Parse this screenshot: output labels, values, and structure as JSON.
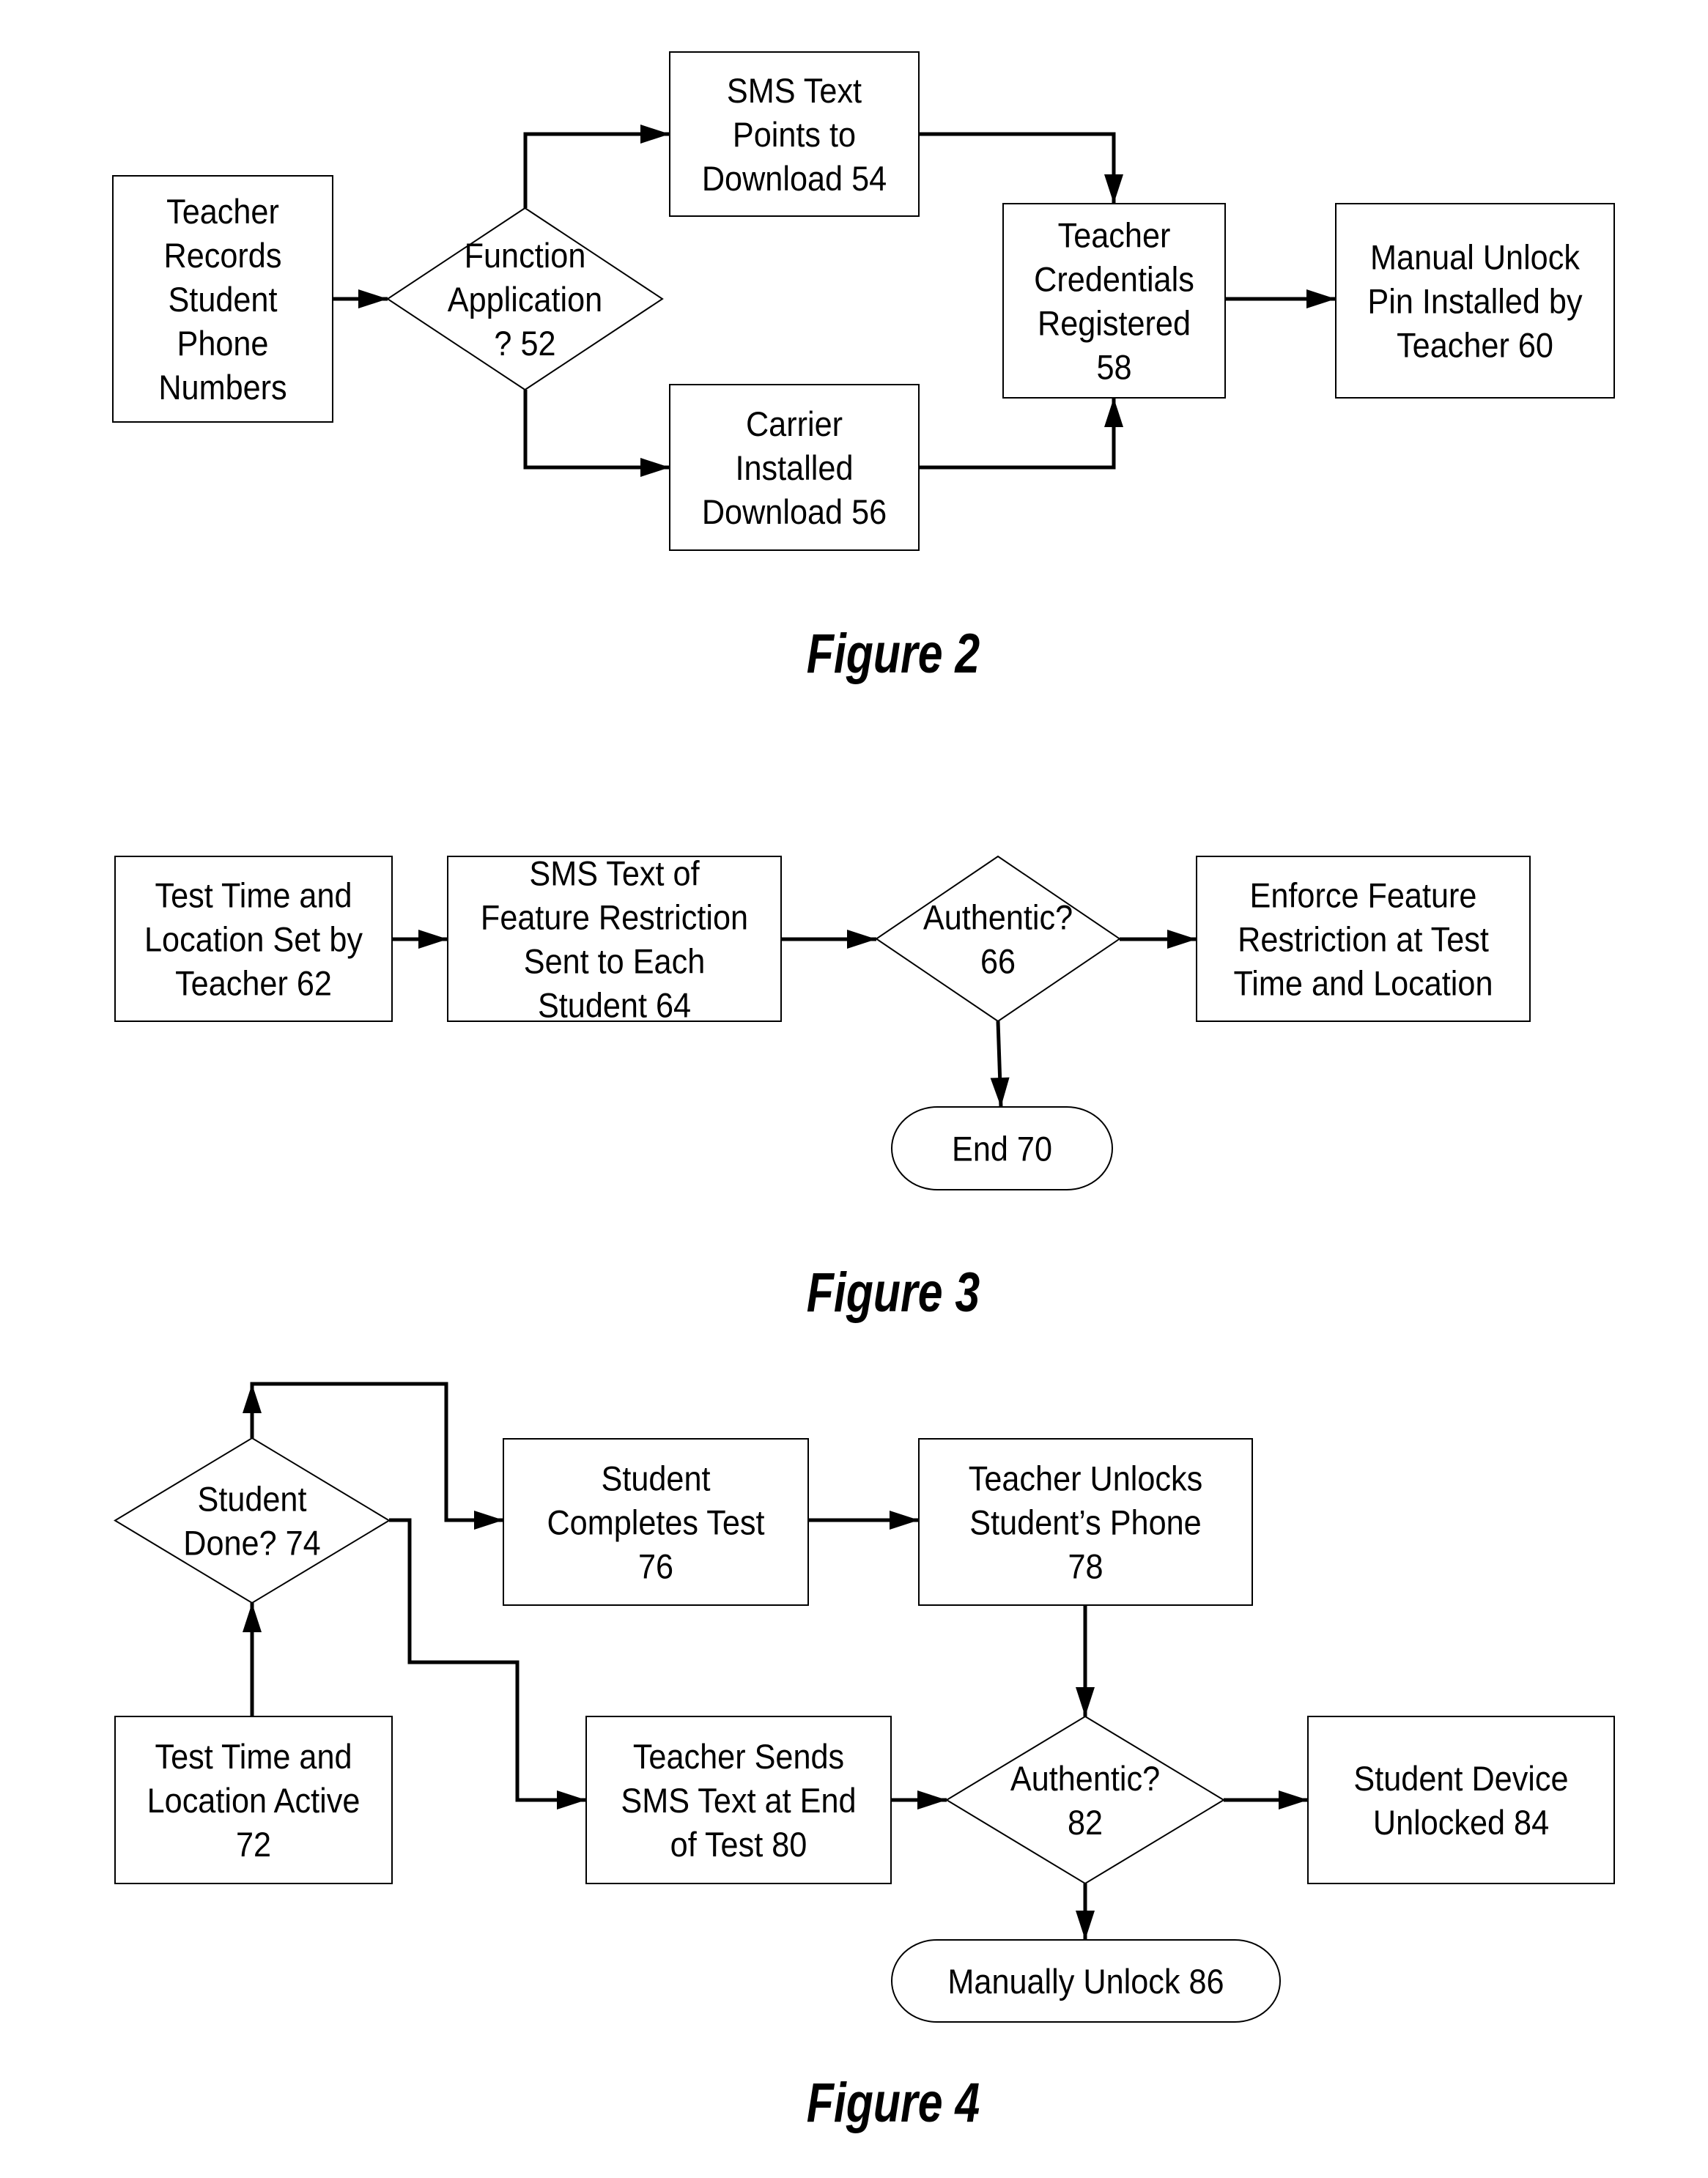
{
  "figures": [
    {
      "caption": "Figure 2",
      "nodes": {
        "teacher_records": {
          "ref": "",
          "lines": [
            "Teacher",
            "Records",
            "Student",
            "Phone",
            "Numbers"
          ],
          "shape": "process"
        },
        "function_application": {
          "ref": "52",
          "lines": [
            "Function",
            "Application",
            "? 52"
          ],
          "shape": "decision"
        },
        "sms_points_download": {
          "ref": "54",
          "lines": [
            "SMS Text",
            "Points to",
            "Download 54"
          ],
          "shape": "process"
        },
        "carrier_installed": {
          "ref": "56",
          "lines": [
            "Carrier",
            "Installed",
            "Download 56"
          ],
          "shape": "process"
        },
        "teacher_credentials": {
          "ref": "58",
          "lines": [
            "Teacher",
            "Credentials",
            "Registered",
            "58"
          ],
          "shape": "process"
        },
        "manual_unlock_pin": {
          "ref": "60",
          "lines": [
            "Manual Unlock",
            "Pin Installed by",
            "Teacher 60"
          ],
          "shape": "process"
        }
      },
      "edges": [
        [
          "teacher_records",
          "function_application"
        ],
        [
          "function_application",
          "sms_points_download"
        ],
        [
          "function_application",
          "carrier_installed"
        ],
        [
          "sms_points_download",
          "teacher_credentials"
        ],
        [
          "carrier_installed",
          "teacher_credentials"
        ],
        [
          "teacher_credentials",
          "manual_unlock_pin"
        ]
      ]
    },
    {
      "caption": "Figure 3",
      "nodes": {
        "test_time_set": {
          "ref": "62",
          "lines": [
            "Test Time and",
            "Location Set by",
            "Teacher 62"
          ],
          "shape": "process"
        },
        "sms_feature_restriction": {
          "ref": "64",
          "lines": [
            "SMS Text of",
            "Feature Restriction",
            "Sent to Each",
            "Student 64"
          ],
          "shape": "process"
        },
        "authentic_66": {
          "ref": "66",
          "lines": [
            "Authentic?",
            "66"
          ],
          "shape": "decision"
        },
        "enforce_restriction": {
          "ref": "",
          "lines": [
            "Enforce Feature",
            "Restriction at Test",
            "Time and Location"
          ],
          "shape": "process"
        },
        "end_70": {
          "ref": "70",
          "lines": [
            "End 70"
          ],
          "shape": "terminator"
        }
      },
      "edges": [
        [
          "test_time_set",
          "sms_feature_restriction"
        ],
        [
          "sms_feature_restriction",
          "authentic_66"
        ],
        [
          "authentic_66",
          "enforce_restriction"
        ],
        [
          "authentic_66",
          "end_70"
        ]
      ]
    },
    {
      "caption": "Figure 4",
      "nodes": {
        "test_time_active": {
          "ref": "72",
          "lines": [
            "Test Time and",
            "Location Active",
            "72"
          ],
          "shape": "process"
        },
        "student_done": {
          "ref": "74",
          "lines": [
            "Student",
            "Done? 74"
          ],
          "shape": "decision"
        },
        "student_completes": {
          "ref": "76",
          "lines": [
            "Student",
            "Completes Test",
            "76"
          ],
          "shape": "process"
        },
        "teacher_unlocks": {
          "ref": "78",
          "lines": [
            "Teacher Unlocks",
            "Student’s Phone",
            "78"
          ],
          "shape": "process"
        },
        "teacher_sends_sms": {
          "ref": "80",
          "lines": [
            "Teacher Sends",
            "SMS Text at End",
            "of Test 80"
          ],
          "shape": "process"
        },
        "authentic_82": {
          "ref": "82",
          "lines": [
            "Authentic?",
            "82"
          ],
          "shape": "decision"
        },
        "device_unlocked": {
          "ref": "84",
          "lines": [
            "Student Device",
            "Unlocked 84"
          ],
          "shape": "process"
        },
        "manually_unlock": {
          "ref": "86",
          "lines": [
            "Manually Unlock 86"
          ],
          "shape": "terminator"
        }
      },
      "edges": [
        [
          "test_time_active",
          "student_done"
        ],
        [
          "student_done",
          "student_completes"
        ],
        [
          "student_done",
          "teacher_sends_sms"
        ],
        [
          "student_completes",
          "teacher_unlocks"
        ],
        [
          "teacher_unlocks",
          "authentic_82"
        ],
        [
          "teacher_sends_sms",
          "authentic_82"
        ],
        [
          "authentic_82",
          "device_unlocked"
        ],
        [
          "authentic_82",
          "manually_unlock"
        ]
      ]
    }
  ]
}
